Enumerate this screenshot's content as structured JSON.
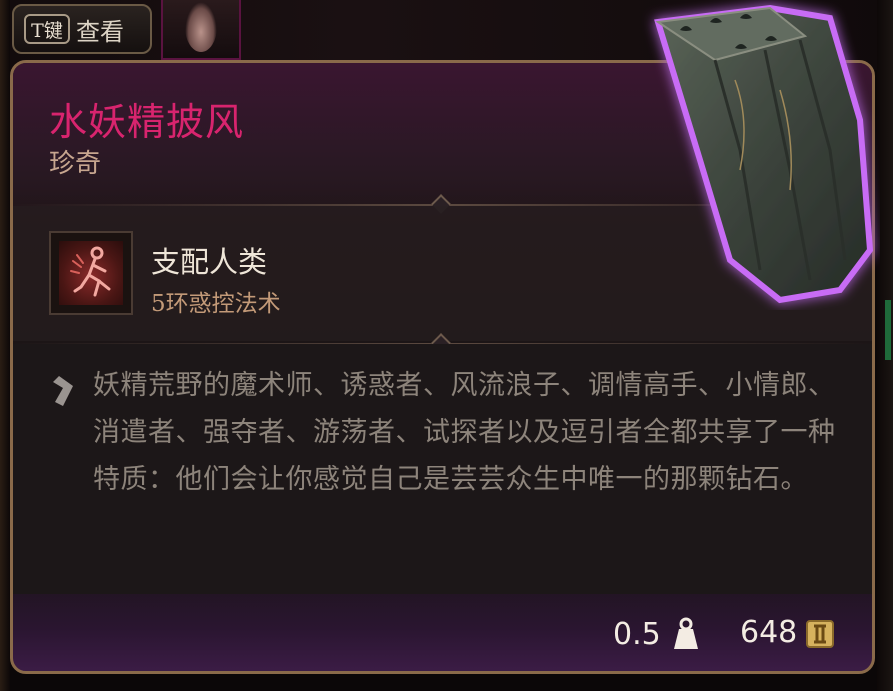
{
  "key_hint": {
    "key": "T键",
    "action": "查看"
  },
  "tooltip": {
    "item_name": "水妖精披风",
    "rarity": "珍奇",
    "spell": {
      "name": "支配人类",
      "level_school": "5环惑控法术",
      "icon": "dominate-person-spell-icon"
    },
    "description": "妖精荒野的魔术师、诱惑者、风流浪子、调情高手、小情郎、消遣者、强夺者、游荡者、试探者以及逗引者全都共享了一种特质：他们会让你感觉自己是芸芸众生中唯一的那颗钻石。",
    "weight": "0.5",
    "price": "648"
  },
  "colors": {
    "rarity_accent": "#d8246e",
    "panel_border": "#8a6a4a",
    "glow": "#b84cf0"
  },
  "icons": {
    "weight": "weight-icon",
    "gold": "gold-coin-icon",
    "description": "quote-mark-icon",
    "item": "cloak-item-icon"
  }
}
